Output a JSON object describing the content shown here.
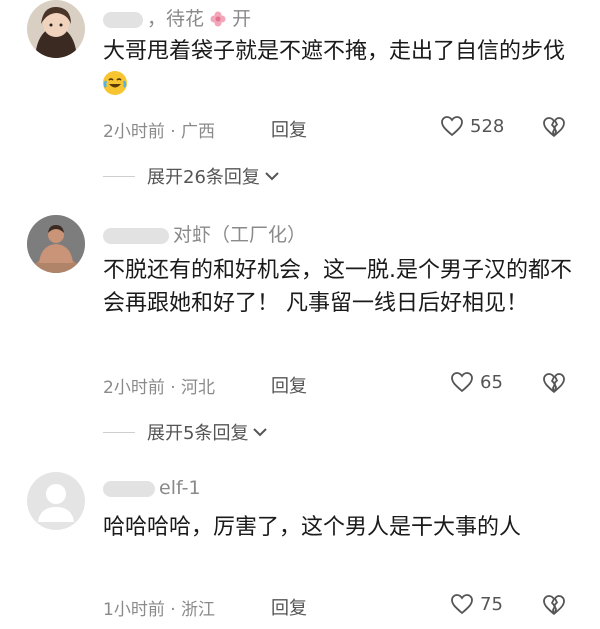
{
  "comments": [
    {
      "username": "，待花",
      "username_suffix": "开",
      "text": "大哥甩着袋子就是不遮不掩，走出了自信的步伐",
      "time": "2小时前",
      "location": "广西",
      "reply_label": "回复",
      "likes": "528",
      "expand_label": "展开26条回复"
    },
    {
      "username": "对虾（工厂化）",
      "text": "不脱还有的和好机会，这一脱.是个男子汉的都不会再跟她和好了！ 凡事留一线日后好相见！",
      "time": "2小时前",
      "location": "河北",
      "reply_label": "回复",
      "likes": "65",
      "expand_label": "展开5条回复"
    },
    {
      "username": "elf-1",
      "text": "哈哈哈哈，厉害了，这个男人是干大事的人",
      "time": "1小时前",
      "location": "浙江",
      "reply_label": "回复",
      "likes": "75"
    }
  ],
  "icons": {
    "like": "heart-outline-icon",
    "dislike": "broken-heart-icon",
    "expand": "chevron-down-icon"
  },
  "colors": {
    "meta": "#8a8a8a",
    "text": "#1a1a1a",
    "divider": "#cfcfcf"
  }
}
